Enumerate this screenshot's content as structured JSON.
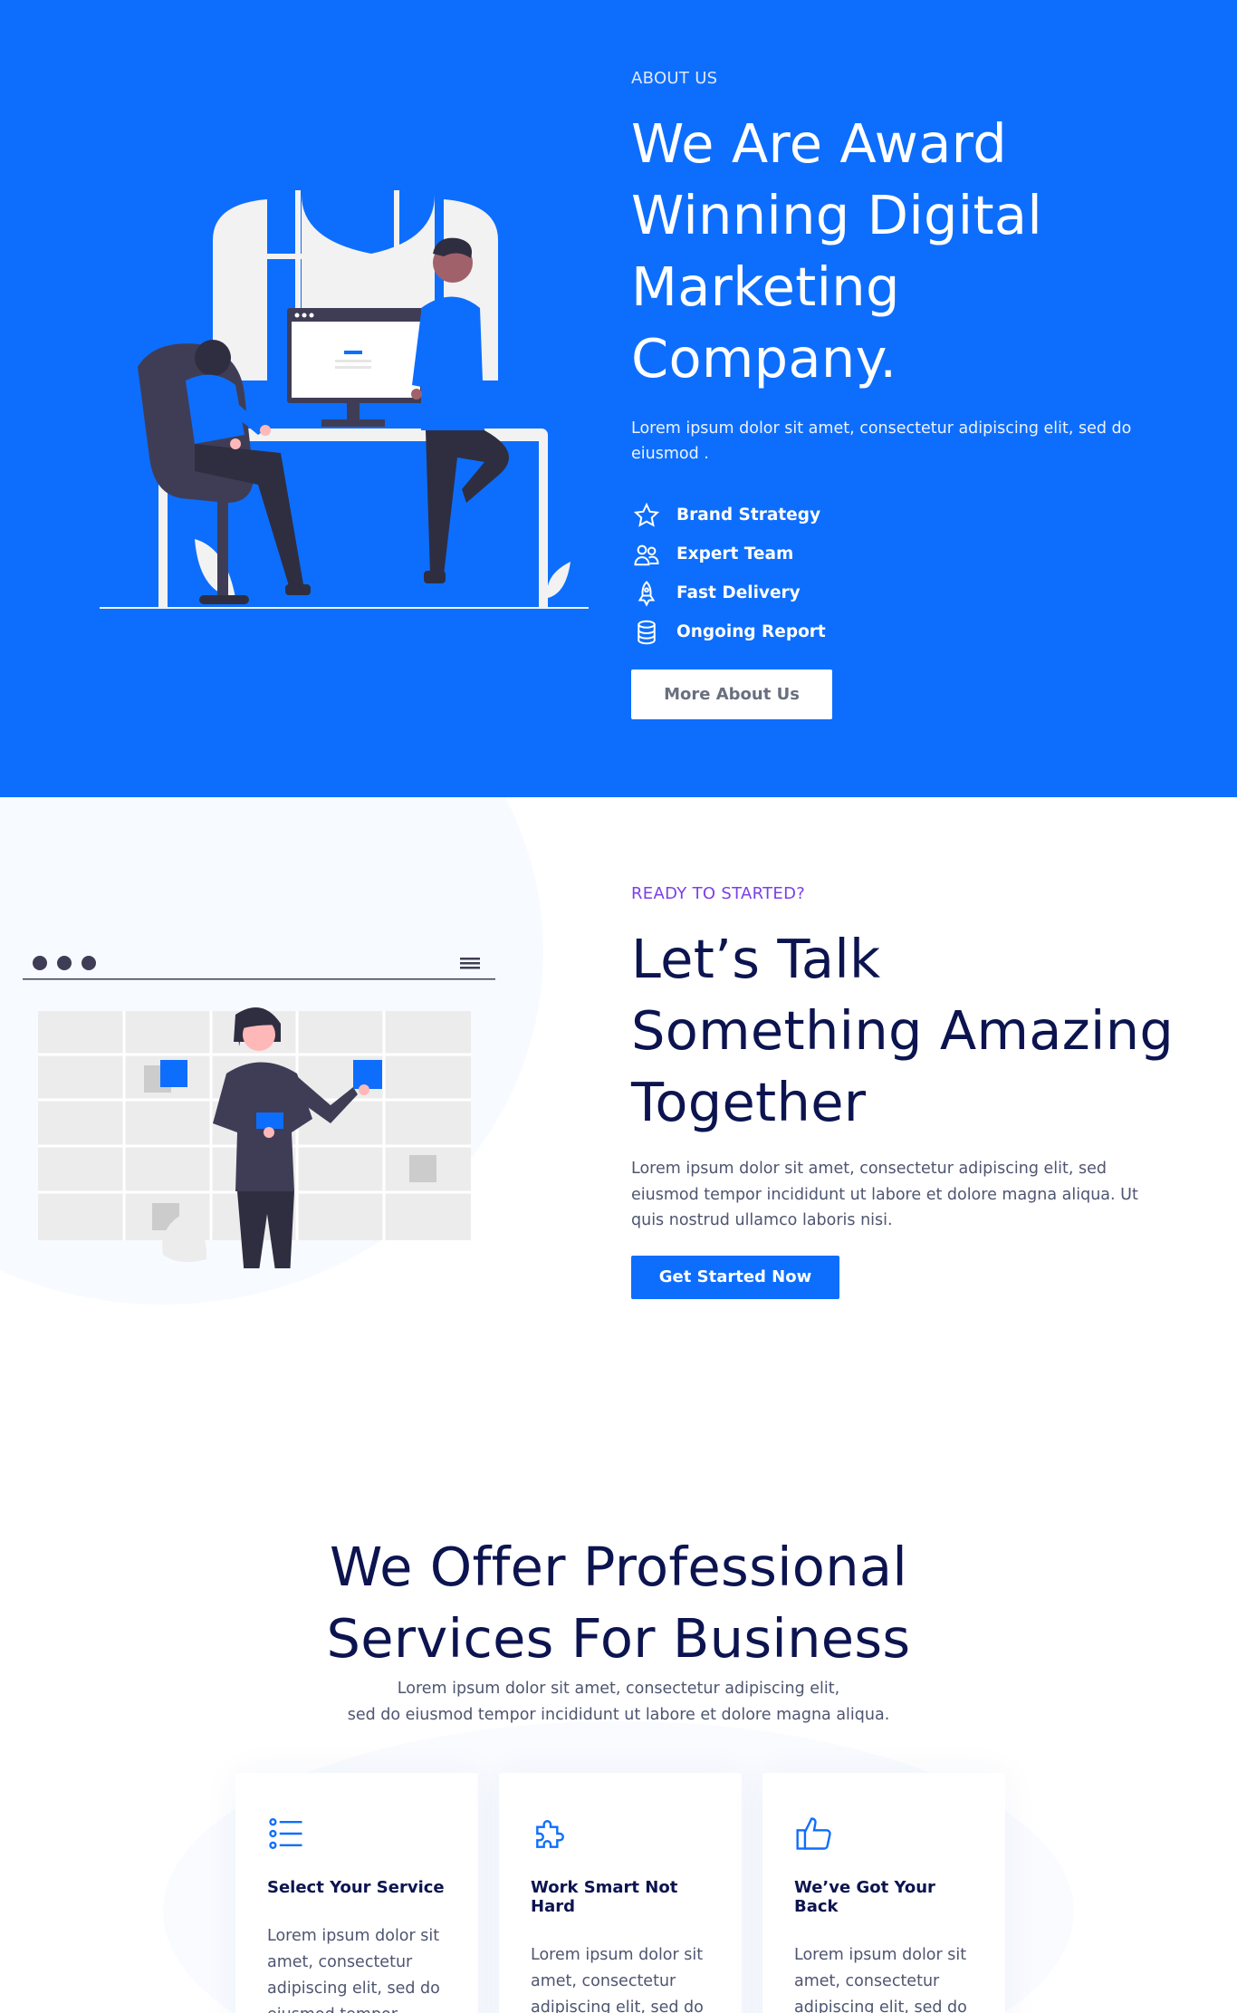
{
  "about": {
    "eyebrow": "ABOUT US",
    "title": "We Are Award Winning Digital Marketing Company.",
    "description": "Lorem ipsum dolor sit amet, consectetur adipiscing elit, sed do eiusmod .",
    "features": [
      {
        "icon": "star-icon",
        "label": "Brand Strategy"
      },
      {
        "icon": "team-icon",
        "label": "Expert Team"
      },
      {
        "icon": "rocket-icon",
        "label": "Fast Delivery"
      },
      {
        "icon": "database-icon",
        "label": "Ongoing Report"
      }
    ],
    "button_label": "More About Us"
  },
  "cta": {
    "eyebrow": "READY TO STARTED?",
    "title": "Let’s Talk Something Amazing Together",
    "description": "Lorem ipsum dolor sit amet, consectetur adipiscing elit, sed eiusmod tempor incididunt ut labore et dolore magna aliqua. Ut quis nostrud ullamco laboris nisi.",
    "button_label": "Get Started Now"
  },
  "services": {
    "title": "We Offer Professional Services For Business",
    "description_line1": "Lorem ipsum dolor sit amet, consectetur adipiscing elit,",
    "description_line2": "sed do eiusmod tempor incididunt ut labore et dolore magna aliqua.",
    "cards": [
      {
        "icon": "list-icon",
        "title": "Select Your Service",
        "text": "Lorem ipsum dolor sit amet, consectetur adipiscing elit, sed do eiusmod tempor"
      },
      {
        "icon": "puzzle-icon",
        "title": "Work Smart Not Hard",
        "text": "Lorem ipsum dolor sit amet, consectetur adipiscing elit, sed do eiusmod tempor"
      },
      {
        "icon": "thumbs-up-icon",
        "title": "We’ve Got Your Back",
        "text": "Lorem ipsum dolor sit amet, consectetur adipiscing elit, sed do eiusmod tempor"
      }
    ]
  },
  "colors": {
    "brand_blue": "#0d6efd",
    "navy": "#0c1450",
    "purple": "#7a40e8",
    "body_text": "#4e5570"
  }
}
